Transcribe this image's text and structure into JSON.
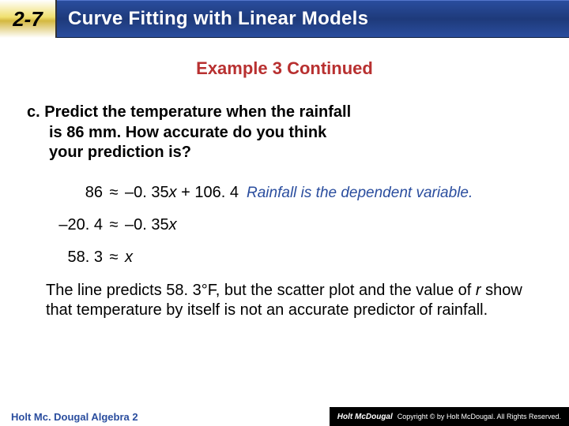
{
  "header": {
    "section": "2-7",
    "title": "Curve Fitting with Linear Models"
  },
  "example_heading": "Example 3 Continued",
  "prompt": {
    "label": "c.",
    "line1": "Predict the temperature when the rainfall",
    "line2": "is 86 mm. How accurate do you think",
    "line3": "your prediction is?"
  },
  "work": {
    "row1": {
      "lhs": "86",
      "approx": "≈",
      "rhs_coef": "–0. 35",
      "rhs_var": "x",
      "rhs_const": " + 106. 4",
      "note": "Rainfall is the dependent variable."
    },
    "row2": {
      "lhs": "–20. 4",
      "approx": "≈",
      "rhs_coef": "–0. 35",
      "rhs_var": "x"
    },
    "row3": {
      "lhs": "58. 3",
      "approx": "≈",
      "rhs_var": "x"
    }
  },
  "conclusion": {
    "part1": "The line predicts 58. 3°F, but the scatter plot and the value of ",
    "rvar": "r",
    "part2": " show that temperature by itself is not an accurate predictor of rainfall."
  },
  "footer": {
    "book": "Holt Mc. Dougal Algebra 2",
    "logo": "Holt McDougal",
    "copyright": "Copyright © by Holt McDougal. All Rights Reserved."
  }
}
